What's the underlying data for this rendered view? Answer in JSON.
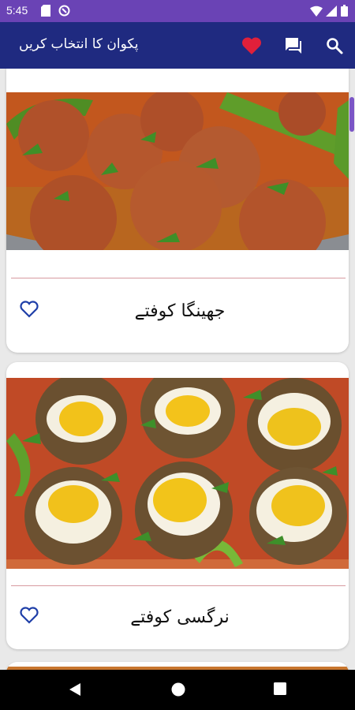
{
  "status": {
    "time": "5:45"
  },
  "appbar": {
    "title": "پکوان کا انتخاب کریں",
    "icons": [
      "heart-icon",
      "chat-icon",
      "search-icon"
    ],
    "heart_color": "#e0203a"
  },
  "recipes": [
    {
      "name": "جھینگا کوفتے",
      "favorite_icon": "heart-outline-icon"
    },
    {
      "name": "نرگسی کوفتے",
      "favorite_icon": "heart-outline-icon"
    }
  ],
  "colors": {
    "status_bar": "#6a43b5",
    "app_bar": "#1f2a80",
    "accent": "#1f2a80"
  }
}
